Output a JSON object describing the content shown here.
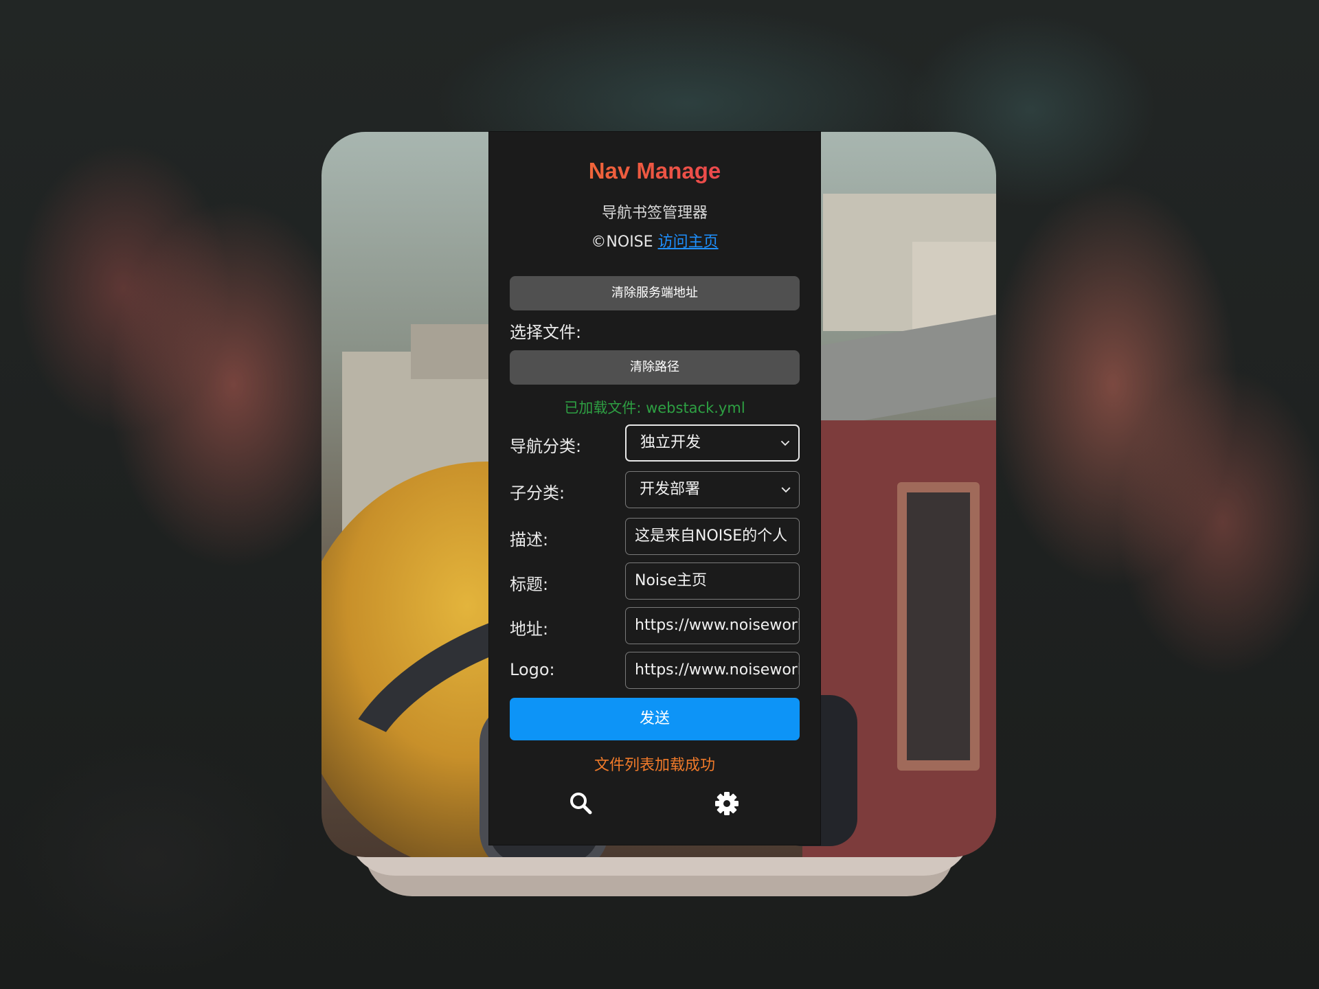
{
  "app": {
    "title": "Nav Manage",
    "subtitle": "导航书签管理器",
    "copyright_prefix": "©NOISE",
    "homepage_link": "访问主页"
  },
  "actions": {
    "clear_server": "清除服务端地址",
    "choose_file_label": "选择文件:",
    "clear_path": "清除路径",
    "send": "发送"
  },
  "status": {
    "loaded_file": "已加载文件: webstack.yml",
    "file_list": "文件列表加载成功"
  },
  "form": {
    "category": {
      "label": "导航分类:",
      "value": "独立开发"
    },
    "subcategory": {
      "label": "子分类:",
      "value": "开发部署"
    },
    "description": {
      "label": "描述:",
      "value": "这是来自NOISE的个人"
    },
    "title": {
      "label": "标题:",
      "value": "Noise主页"
    },
    "url": {
      "label": "地址:",
      "value": "https://www.noisework"
    },
    "logo": {
      "label": "Logo:",
      "value": "https://www.noisework"
    }
  },
  "icons": {
    "search": "search-icon",
    "settings": "gear-icon"
  },
  "colors": {
    "title_gradient_start": "#f2792a",
    "title_gradient_end": "#e8345c",
    "link": "#1e90ff",
    "status_success": "#2ea043",
    "status_info": "#f07a2a",
    "send_button": "#0d94f7"
  }
}
